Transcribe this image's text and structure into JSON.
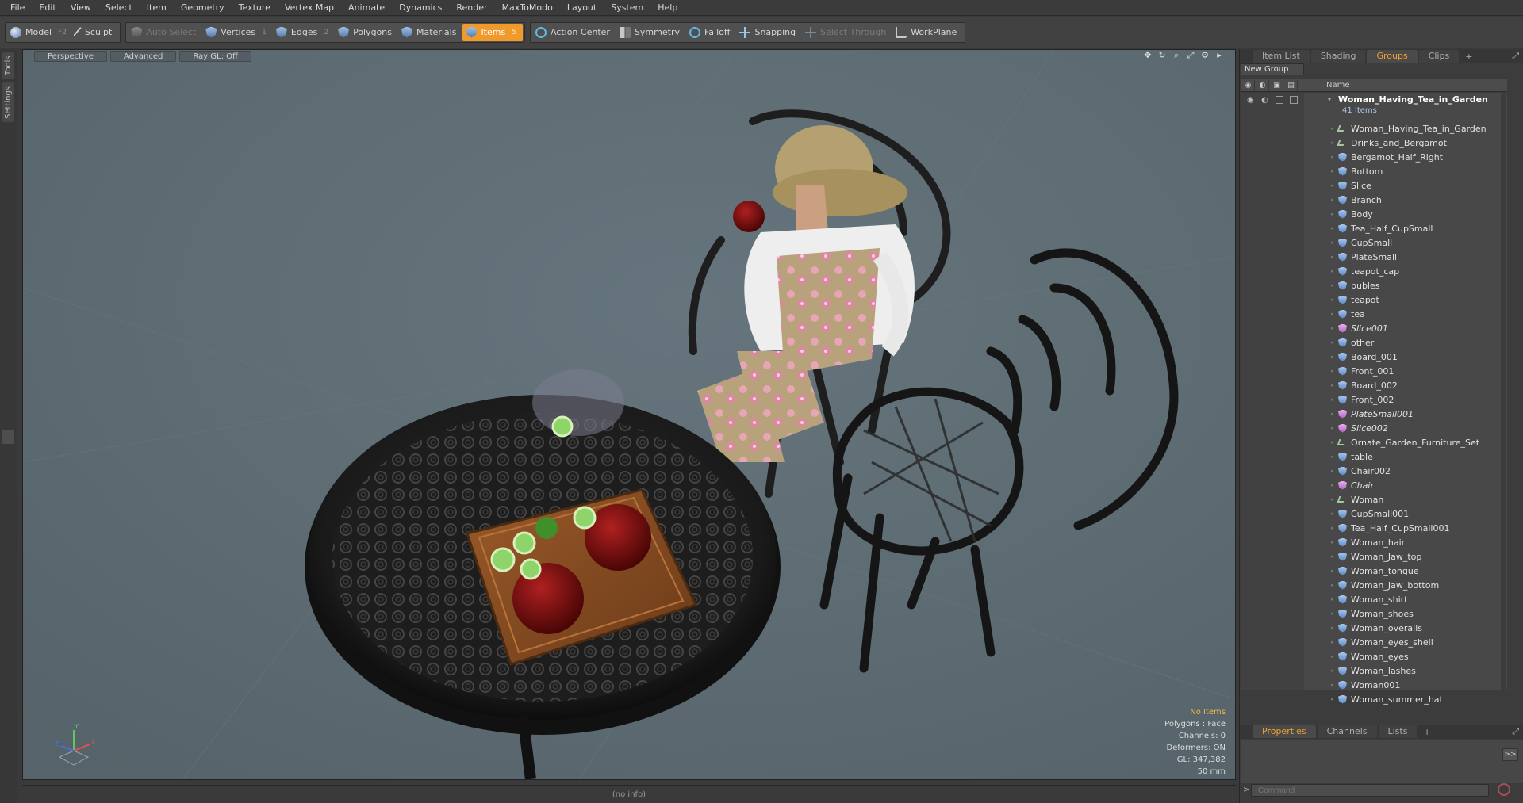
{
  "menu": [
    "File",
    "Edit",
    "View",
    "Select",
    "Item",
    "Geometry",
    "Texture",
    "Vertex Map",
    "Animate",
    "Dynamics",
    "Render",
    "MaxToModo",
    "Layout",
    "System",
    "Help"
  ],
  "toolbar": {
    "model": {
      "label": "Model",
      "key": "F2"
    },
    "sculpt": {
      "label": "Sculpt"
    },
    "auto_select": {
      "label": "Auto Select"
    },
    "vertices": {
      "label": "Vertices",
      "key": "1"
    },
    "edges": {
      "label": "Edges",
      "key": "2"
    },
    "polygons": {
      "label": "Polygons"
    },
    "materials": {
      "label": "Materials"
    },
    "items": {
      "label": "Items",
      "key": "5"
    },
    "action_center": {
      "label": "Action Center"
    },
    "symmetry": {
      "label": "Symmetry"
    },
    "falloff": {
      "label": "Falloff"
    },
    "snapping": {
      "label": "Snapping"
    },
    "select_through": {
      "label": "Select Through"
    },
    "workplane": {
      "label": "WorkPlane"
    },
    "active_color": "#f09a2c"
  },
  "left_tabs": [
    "Tools",
    "Settings"
  ],
  "viewport": {
    "tabs": [
      "Perspective",
      "Advanced",
      "Ray GL: Off"
    ],
    "nav_icons": [
      "move-view-icon",
      "rotate-view-icon",
      "zoom-view-icon",
      "fit-view-icon",
      "viewport-settings-icon",
      "expand-icon"
    ],
    "info": {
      "selection": "No Items",
      "polygons": "Polygons : Face",
      "channels": "Channels: 0",
      "deformers": "Deformers: ON",
      "gl": "GL: 347,382",
      "focal": "50 mm"
    },
    "axes": {
      "x": "X",
      "y": "Y",
      "z": "Z"
    },
    "background": "#5d6b73"
  },
  "right_panel": {
    "tabs": [
      "Item List",
      "Shading",
      "Groups",
      "Clips"
    ],
    "active_tab": "Groups",
    "new_group": "New Group",
    "column_name": "Name",
    "root": {
      "name": "Woman_Having_Tea_in_Garden",
      "count": "41 Items"
    },
    "items": [
      {
        "name": "Woman_Having_Tea_in_Garden",
        "icon": "locator"
      },
      {
        "name": "Drinks_and_Bergamot",
        "icon": "locator"
      },
      {
        "name": "Bergamot_Half_Right",
        "icon": "mesh"
      },
      {
        "name": "Bottom",
        "icon": "mesh"
      },
      {
        "name": "Slice",
        "icon": "mesh"
      },
      {
        "name": "Branch",
        "icon": "mesh"
      },
      {
        "name": "Body",
        "icon": "mesh"
      },
      {
        "name": "Tea_Half_CupSmall",
        "icon": "mesh"
      },
      {
        "name": "CupSmall",
        "icon": "mesh"
      },
      {
        "name": "PlateSmall",
        "icon": "mesh"
      },
      {
        "name": "teapot_cap",
        "icon": "mesh"
      },
      {
        "name": "bubles",
        "icon": "mesh"
      },
      {
        "name": "teapot",
        "icon": "mesh"
      },
      {
        "name": "tea",
        "icon": "mesh"
      },
      {
        "name": "Slice001",
        "icon": "instance"
      },
      {
        "name": "other",
        "icon": "mesh"
      },
      {
        "name": "Board_001",
        "icon": "mesh"
      },
      {
        "name": "Front_001",
        "icon": "mesh"
      },
      {
        "name": "Board_002",
        "icon": "mesh"
      },
      {
        "name": "Front_002",
        "icon": "mesh"
      },
      {
        "name": "PlateSmall001",
        "icon": "instance"
      },
      {
        "name": "Slice002",
        "icon": "instance"
      },
      {
        "name": "Ornate_Garden_Furniture_Set",
        "icon": "locator"
      },
      {
        "name": "table",
        "icon": "mesh"
      },
      {
        "name": "Chair002",
        "icon": "mesh"
      },
      {
        "name": "Chair",
        "icon": "instance"
      },
      {
        "name": "Woman",
        "icon": "locator"
      },
      {
        "name": "CupSmall001",
        "icon": "mesh"
      },
      {
        "name": "Tea_Half_CupSmall001",
        "icon": "mesh"
      },
      {
        "name": "Woman_hair",
        "icon": "mesh"
      },
      {
        "name": "Woman_Jaw_top",
        "icon": "mesh"
      },
      {
        "name": "Woman_tongue",
        "icon": "mesh"
      },
      {
        "name": "Woman_Jaw_bottom",
        "icon": "mesh"
      },
      {
        "name": "Woman_shirt",
        "icon": "mesh"
      },
      {
        "name": "Woman_shoes",
        "icon": "mesh"
      },
      {
        "name": "Woman_overalls",
        "icon": "mesh"
      },
      {
        "name": "Woman_eyes_shell",
        "icon": "mesh"
      },
      {
        "name": "Woman_eyes",
        "icon": "mesh"
      },
      {
        "name": "Woman_lashes",
        "icon": "mesh"
      },
      {
        "name": "Woman001",
        "icon": "mesh"
      },
      {
        "name": "Woman_summer_hat",
        "icon": "mesh"
      }
    ],
    "bottom_tabs": [
      "Properties",
      "Channels",
      "Lists"
    ],
    "bottom_active": "Properties",
    "expand_label": ">>",
    "command_prompt": ">",
    "command_placeholder": "Command"
  },
  "status": "(no info)"
}
